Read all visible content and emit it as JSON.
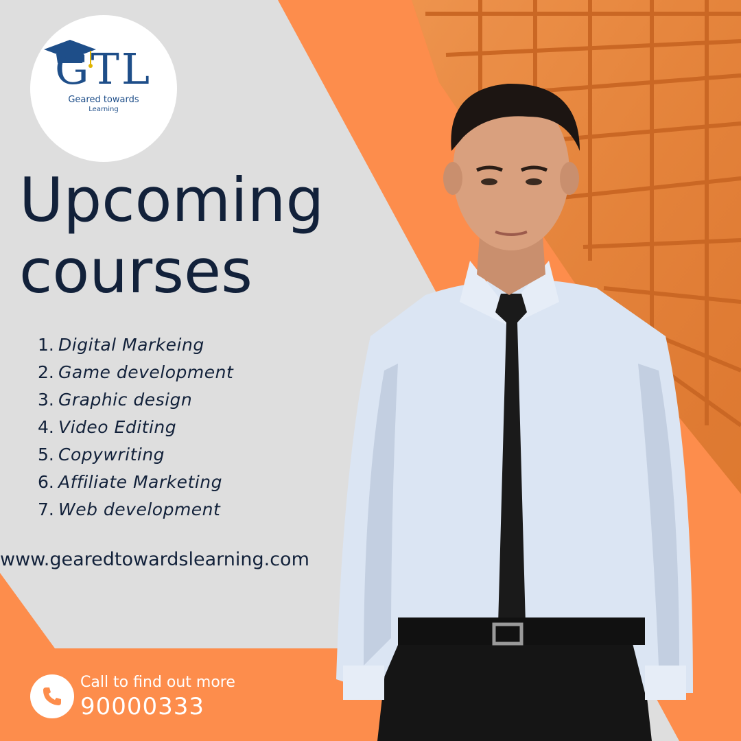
{
  "colors": {
    "background": "#dedede",
    "accent_orange": "#fd8d4c",
    "navy_text": "#12213a",
    "logo_blue": "#1e4e89",
    "white": "#ffffff"
  },
  "logo": {
    "mark": "GTL",
    "tagline": "Geared towards",
    "tagline_sub": "Learning",
    "icon": "graduation-cap-icon"
  },
  "headline": {
    "line1": "Upcoming",
    "line2": "courses"
  },
  "courses": [
    {
      "num": "1.",
      "name": "Digital Markeing"
    },
    {
      "num": "2.",
      "name": "Game development"
    },
    {
      "num": "3.",
      "name": "Graphic design"
    },
    {
      "num": "4.",
      "name": "Video Editing"
    },
    {
      "num": "5.",
      "name": "Copywriting"
    },
    {
      "num": "6.",
      "name": "Affiliate Marketing"
    },
    {
      "num": "7.",
      "name": "Web development"
    }
  ],
  "website": "www.gearedtowardslearning.com",
  "contact": {
    "icon": "phone-icon",
    "cta": "Call to find out more",
    "phone": "90000333"
  }
}
